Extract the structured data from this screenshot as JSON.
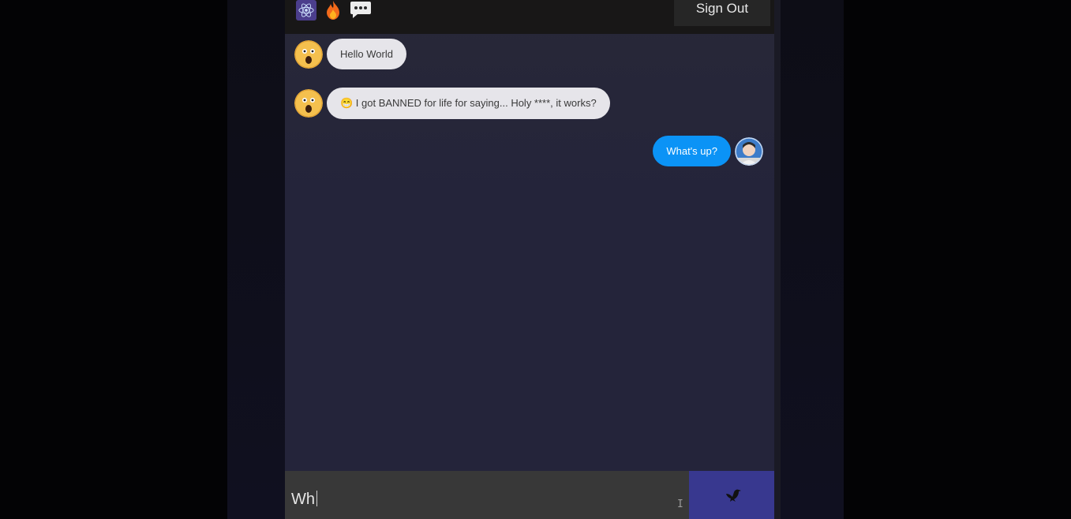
{
  "header": {
    "icons": [
      "react-icon",
      "fire-icon",
      "speech-bubble-icon"
    ],
    "sign_out_label": "Sign Out"
  },
  "messages": [
    {
      "side": "received",
      "avatar": "emoji-face-avatar",
      "text": "Hello World"
    },
    {
      "side": "received",
      "avatar": "emoji-face-avatar",
      "text": "😁 I got BANNED for life for saying... Holy ****, it works?"
    },
    {
      "side": "sent",
      "avatar": "user-photo-avatar",
      "text": "What's up?"
    }
  ],
  "composer": {
    "value": "Wh",
    "send_icon": "dove-icon"
  },
  "colors": {
    "header_bg": "#181717",
    "chat_bg": "#282838",
    "received_bubble": "#e6e5ea",
    "sent_bubble": "#0b93f6",
    "send_button": "#38388f"
  }
}
